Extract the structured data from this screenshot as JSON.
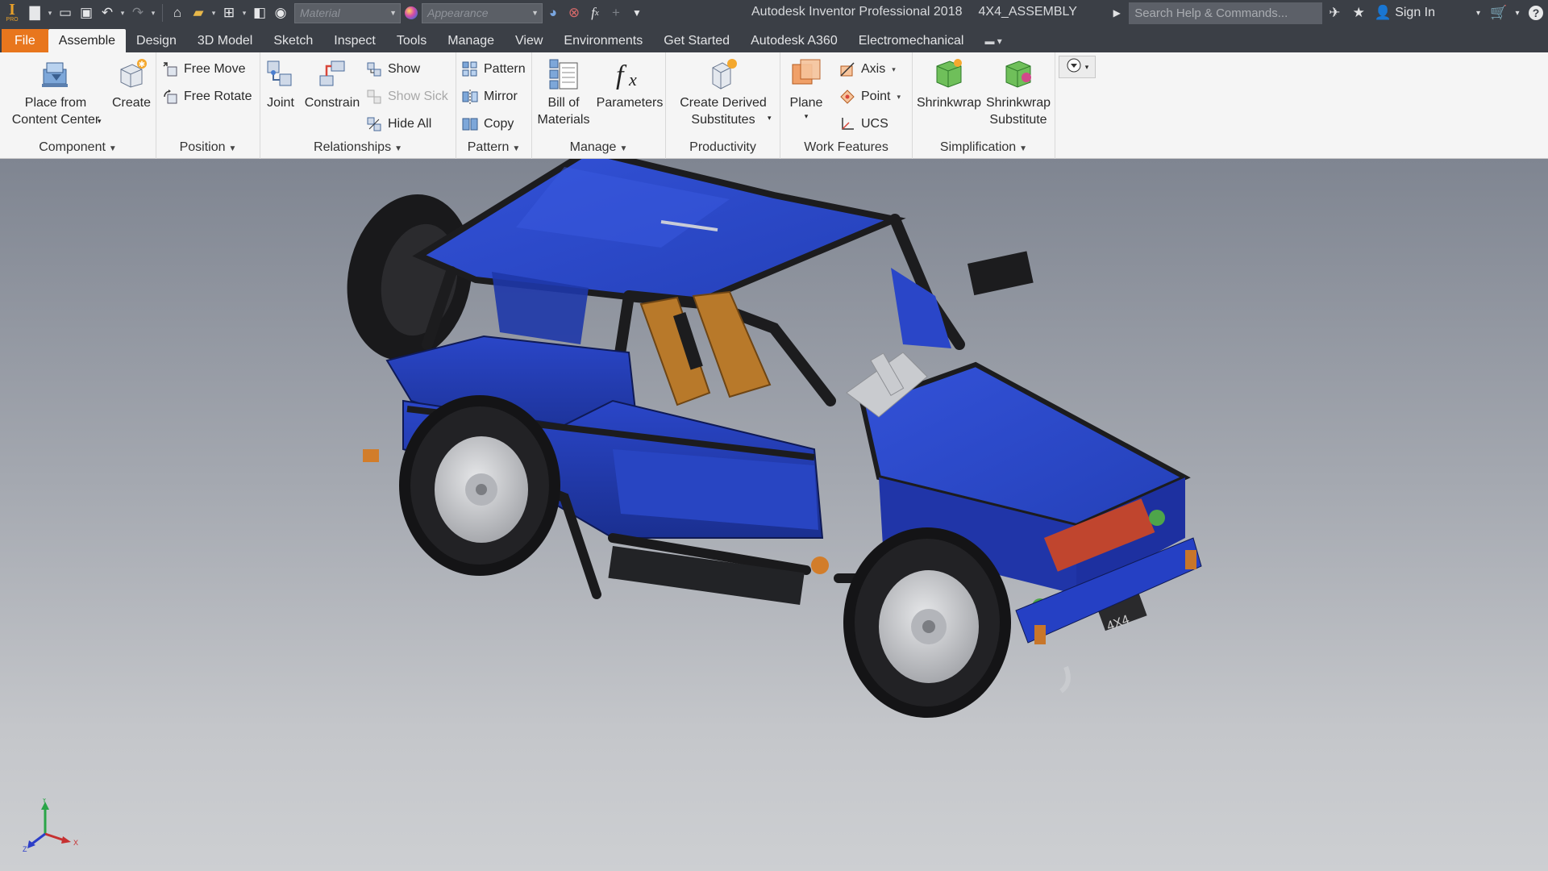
{
  "window": {
    "app_title": "Autodesk Inventor Professional 2018",
    "document_title": "4X4_ASSEMBLY",
    "logo_pro": "PRO"
  },
  "quick_access": {
    "material_placeholder": "Material",
    "appearance_placeholder": "Appearance",
    "fx_symbol": "f",
    "fx_sub": "x"
  },
  "header_right": {
    "search_placeholder": "Search Help & Commands...",
    "sign_in": "Sign In"
  },
  "tabs": [
    {
      "label": "File"
    },
    {
      "label": "Assemble",
      "active": true
    },
    {
      "label": "Design"
    },
    {
      "label": "3D Model"
    },
    {
      "label": "Sketch"
    },
    {
      "label": "Inspect"
    },
    {
      "label": "Tools"
    },
    {
      "label": "Manage"
    },
    {
      "label": "View"
    },
    {
      "label": "Environments"
    },
    {
      "label": "Get Started"
    },
    {
      "label": "Autodesk A360"
    },
    {
      "label": "Electromechanical"
    }
  ],
  "ribbon": {
    "component": {
      "title": "Component",
      "place_from_content_center": [
        "Place from",
        "Content Center"
      ],
      "create": "Create"
    },
    "position": {
      "title": "Position",
      "free_move": "Free Move",
      "free_rotate": "Free Rotate"
    },
    "relationships": {
      "title": "Relationships",
      "joint": "Joint",
      "constrain": "Constrain",
      "show": "Show",
      "show_sick": "Show Sick",
      "hide_all": "Hide All"
    },
    "pattern": {
      "title": "Pattern",
      "pattern": "Pattern",
      "mirror": "Mirror",
      "copy": "Copy"
    },
    "manage": {
      "title": "Manage",
      "bill_of_materials": [
        "Bill of",
        "Materials"
      ],
      "parameters": "Parameters"
    },
    "productivity": {
      "title": "Productivity",
      "create_derived_substitutes": [
        "Create Derived",
        "Substitutes"
      ]
    },
    "work_features": {
      "title": "Work Features",
      "plane": "Plane",
      "axis": "Axis",
      "point": "Point",
      "ucs": "UCS"
    },
    "simplification": {
      "title": "Simplification",
      "shrinkwrap": "Shrinkwrap",
      "shrinkwrap_substitute": [
        "Shrinkwrap",
        "Substitute"
      ]
    }
  },
  "viewport": {
    "plate_text": "4X4",
    "triad": {
      "x": "X",
      "y": "Y",
      "z": "Z"
    },
    "colors": {
      "body": "#2b49d6",
      "frame": "#1c1c1e",
      "seat": "#b8792a",
      "rim": "#c8c9cc"
    }
  }
}
